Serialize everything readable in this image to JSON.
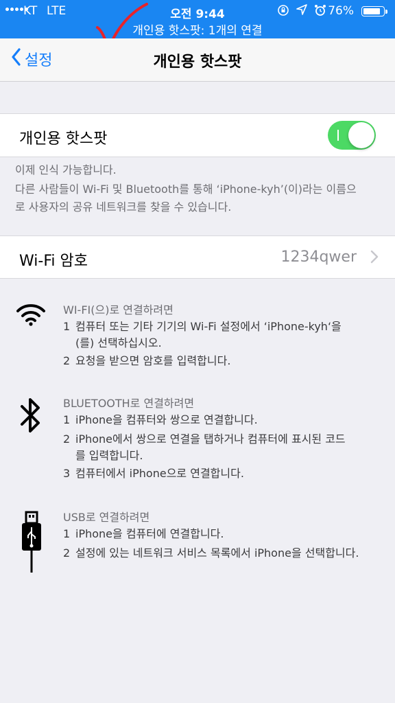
{
  "status_bar": {
    "carrier": "KT",
    "network": "LTE",
    "time": "오전 9:44",
    "battery_percent": "76%",
    "battery_level": 0.76,
    "icons": [
      "screen-rotation-lock-icon",
      "location-arrow-icon",
      "alarm-clock-icon"
    ],
    "hotspot_banner": "개인용 핫스팟: 1개의 연결",
    "bar_color": "#1a86f2"
  },
  "nav": {
    "back_label": "설정",
    "title": "개인용 핫스팟"
  },
  "hotspot": {
    "label": "개인용 핫스팟",
    "enabled": true,
    "toggle_color": "#4cd964",
    "footer_line1": "이제 인식 가능합니다.",
    "footer_line2": "다른 사람들이 Wi-Fi 및 Bluetooth를 통해 ‘iPhone-kyh’(이)라는 이름으",
    "footer_line3": "로 사용자의 공유 네트워크를 찾을 수 있습니다."
  },
  "wifi_password": {
    "label": "Wi-Fi 암호",
    "value": "1234qwer"
  },
  "instructions": {
    "wifi": {
      "heading": "WI-FI(으)로 연결하려면",
      "step1_num": "1",
      "step1_line1": "컴퓨터 또는 기타 기기의 Wi-Fi 설정에서 ‘iPhone-kyh‘을",
      "step1_line2": "(를) 선택하십시오.",
      "step2_num": "2",
      "step2": "요청을 받으면 암호를 입력합니다."
    },
    "bluetooth": {
      "heading": "BLUETOOTH로 연결하려면",
      "step1_num": "1",
      "step1": "iPhone을 컴퓨터와 쌍으로 연결합니다.",
      "step2_num": "2",
      "step2_line1": "iPhone에서 쌍으로 연결을 탭하거나 컴퓨터에 표시된 코드",
      "step2_line2": "를 입력합니다.",
      "step3_num": "3",
      "step3": "컴퓨터에서 iPhone으로 연결합니다."
    },
    "usb": {
      "heading": "USB로 연결하려면",
      "step1_num": "1",
      "step1": "iPhone을 컴퓨터에 연결합니다.",
      "step2_num": "2",
      "step2": "설정에 있는 네트워크 서비스 목록에서 iPhone을 선택합니다."
    }
  }
}
